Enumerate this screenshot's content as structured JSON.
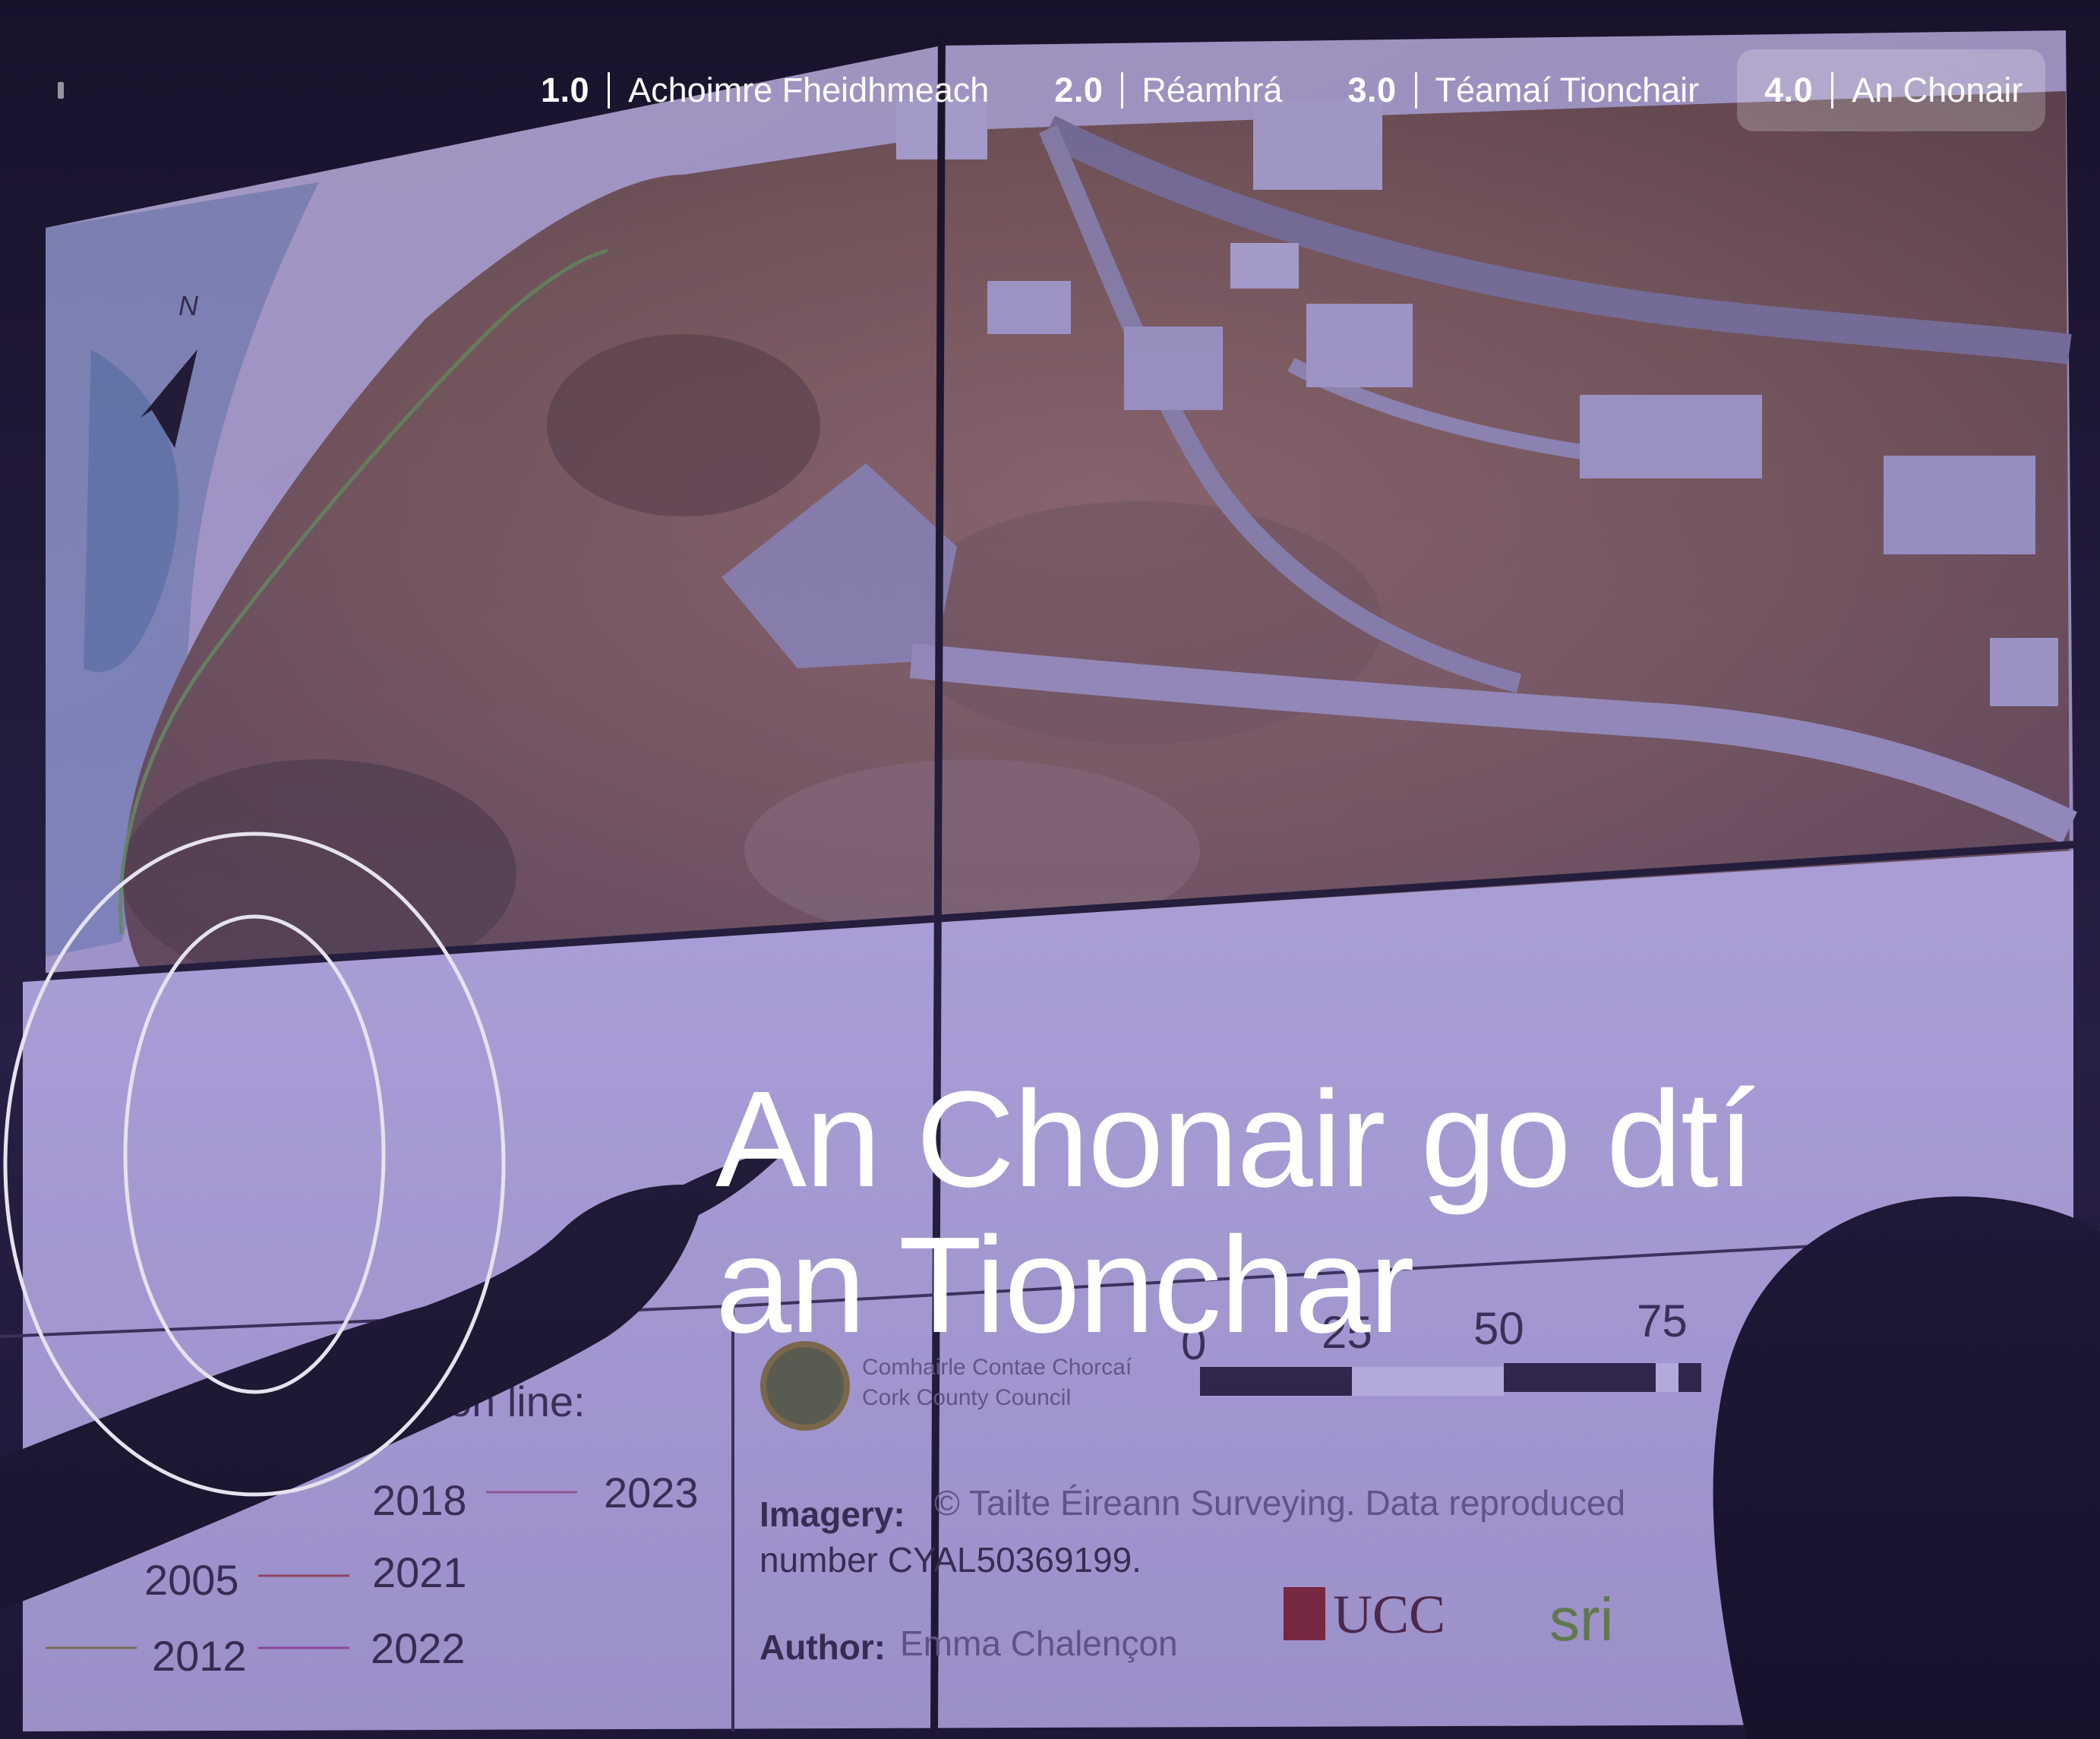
{
  "nav": {
    "items": [
      {
        "number": "1.0",
        "label": "Achoimre Fheidhmeach",
        "active": false
      },
      {
        "number": "2.0",
        "label": "Réamhrá",
        "active": false
      },
      {
        "number": "3.0",
        "label": "Téamaí Tionchair",
        "active": false
      },
      {
        "number": "4.0",
        "label": "An Chonair",
        "active": true
      }
    ]
  },
  "hero": {
    "section_numeral": "0",
    "title_line1": "An Chonair go dtí",
    "title_line2": "an Tionchar"
  },
  "background": {
    "scale_numbers": [
      "0",
      "25",
      "50",
      "75"
    ],
    "legend_heading_fragment": "on line:",
    "legend_years": [
      "2005",
      "2012",
      "2018",
      "2021",
      "2022",
      "2023"
    ],
    "council_irish": "Comhairle Contae Chorcaí",
    "council_english": "Cork County Council",
    "imagery_label": "Imagery:",
    "imagery_text": "© Tailte Éireann Surveying. Data reproduced",
    "imagery_number": "number CYAL50369199.",
    "author_label": "Author:",
    "author_name": "Emma Chalençon",
    "logo_ucc": "UCC",
    "logo_sri": "sri",
    "north_label": "N"
  },
  "colors": {
    "overlay": "#6654b4",
    "text": "#ffffff",
    "active_tab_bg": "rgba(255,255,255,0.22)"
  }
}
